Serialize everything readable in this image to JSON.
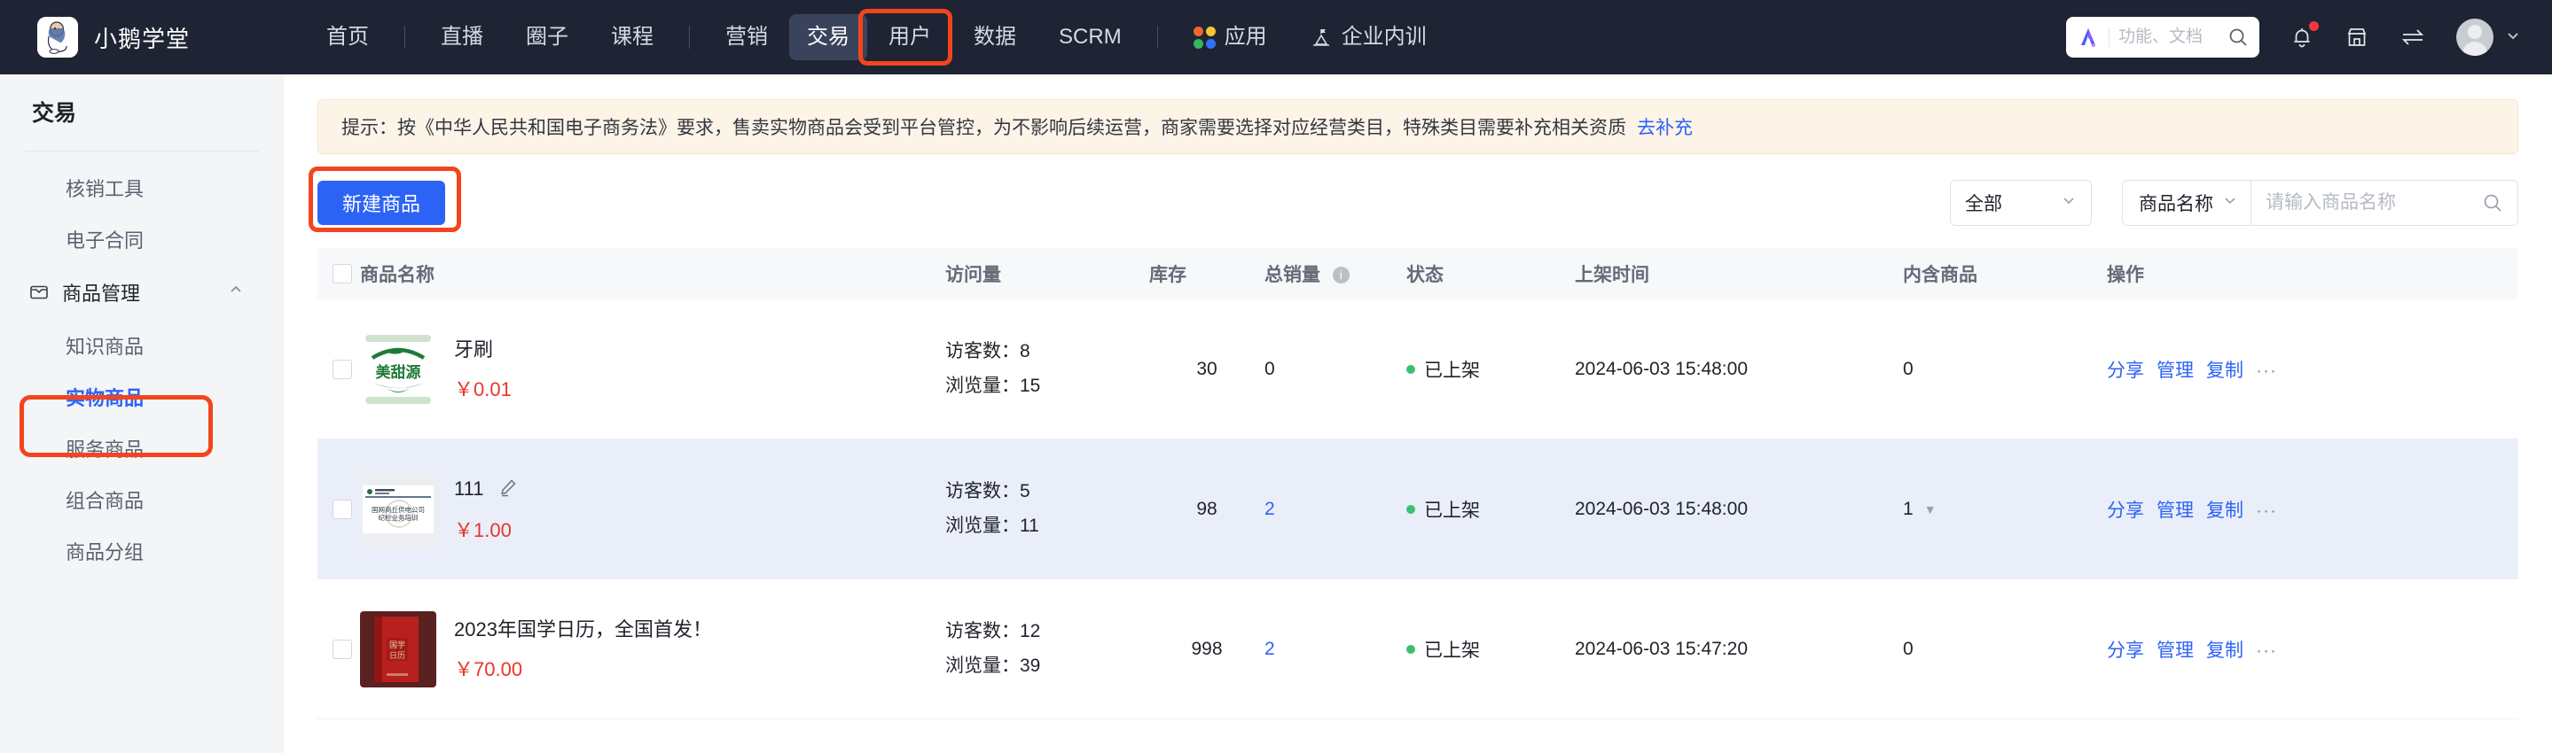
{
  "header": {
    "brand": "小鹅学堂",
    "nav": [
      {
        "label": "首页",
        "active": false,
        "sep_after": true
      },
      {
        "label": "直播",
        "active": false,
        "sep_after": false
      },
      {
        "label": "圈子",
        "active": false,
        "sep_after": false
      },
      {
        "label": "课程",
        "active": false,
        "sep_after": true
      },
      {
        "label": "营销",
        "active": false,
        "sep_after": false
      },
      {
        "label": "交易",
        "active": true,
        "sep_after": false
      },
      {
        "label": "用户",
        "active": false,
        "sep_after": false
      },
      {
        "label": "数据",
        "active": false,
        "sep_after": false
      },
      {
        "label": "SCRM",
        "active": false,
        "sep_after": true
      },
      {
        "label": "应用",
        "active": false,
        "sep_after": false,
        "icon": "app-grid-icon"
      },
      {
        "label": "企业内训",
        "active": false,
        "sep_after": false,
        "icon": "enterprise-training-icon"
      }
    ],
    "search_placeholder": "功能、文档",
    "search_value": "",
    "icons": [
      "ai-logo-icon",
      "search-icon",
      "bell-icon",
      "store-icon",
      "switch-icon",
      "avatar",
      "chevron-down-icon"
    ],
    "notification_badge": true,
    "accent_nav_bg": "#1e2433",
    "annotation_color": "#f4441e"
  },
  "sidebar": {
    "title": "交易",
    "items": [
      {
        "label": "核销工具",
        "type": "item",
        "selected": false
      },
      {
        "label": "电子合同",
        "type": "item",
        "selected": false
      },
      {
        "label": "商品管理",
        "type": "group",
        "expanded": true,
        "icon": "box-icon"
      },
      {
        "label": "知识商品",
        "type": "item",
        "selected": false
      },
      {
        "label": "实物商品",
        "type": "item",
        "selected": true,
        "annotated": true
      },
      {
        "label": "服务商品",
        "type": "item",
        "selected": false
      },
      {
        "label": "组合商品",
        "type": "item",
        "selected": false
      },
      {
        "label": "商品分组",
        "type": "item",
        "selected": false
      }
    ]
  },
  "notice": {
    "text": "提示：按《中华人民共和国电子商务法》要求，售卖实物商品会受到平台管控，为不影响后续运营，商家需要选择对应经营类目，特殊类目需要补充相关资质",
    "link": "去补充"
  },
  "toolbar": {
    "create_button": "新建商品",
    "status_filter_value": "全部",
    "search_field_value": "商品名称",
    "search_placeholder": "请输入商品名称",
    "search_value": ""
  },
  "table": {
    "columns": [
      "商品名称",
      "访问量",
      "库存",
      "总销量",
      "状态",
      "上架时间",
      "内含商品",
      "操作"
    ],
    "sales_info_tooltip_icon": "info-icon",
    "rows": [
      {
        "name": "牙刷",
        "price": "￥0.01",
        "thumb": "mei-tian-yuan-logo",
        "visitors_label": "访客数：",
        "visitors": "8",
        "views_label": "浏览量：",
        "views": "15",
        "stock": "30",
        "sales": "0",
        "sales_is_link": false,
        "status": "已上架",
        "listed_at": "2024-06-03 15:48:00",
        "included": "0",
        "included_has_caret": false,
        "editable_name": false,
        "highlighted": false,
        "ops": [
          "分享",
          "管理",
          "复制"
        ],
        "ops_more": "···"
      },
      {
        "name": "111",
        "price": "￥1.00",
        "thumb": "training-slide",
        "visitors_label": "访客数：",
        "visitors": "5",
        "views_label": "浏览量：",
        "views": "11",
        "stock": "98",
        "sales": "2",
        "sales_is_link": true,
        "status": "已上架",
        "listed_at": "2024-06-03 15:48:00",
        "included": "1",
        "included_has_caret": true,
        "editable_name": true,
        "highlighted": true,
        "ops": [
          "分享",
          "管理",
          "复制"
        ],
        "ops_more": "···"
      },
      {
        "name": "2023年国学日历，全国首发！",
        "price": "￥70.00",
        "thumb": "red-calendar-book",
        "visitors_label": "访客数：",
        "visitors": "12",
        "views_label": "浏览量：",
        "views": "39",
        "stock": "998",
        "sales": "2",
        "sales_is_link": true,
        "status": "已上架",
        "listed_at": "2024-06-03 15:47:20",
        "included": "0",
        "included_has_caret": false,
        "editable_name": false,
        "highlighted": false,
        "ops": [
          "分享",
          "管理",
          "复制"
        ],
        "ops_more": "···"
      }
    ]
  }
}
